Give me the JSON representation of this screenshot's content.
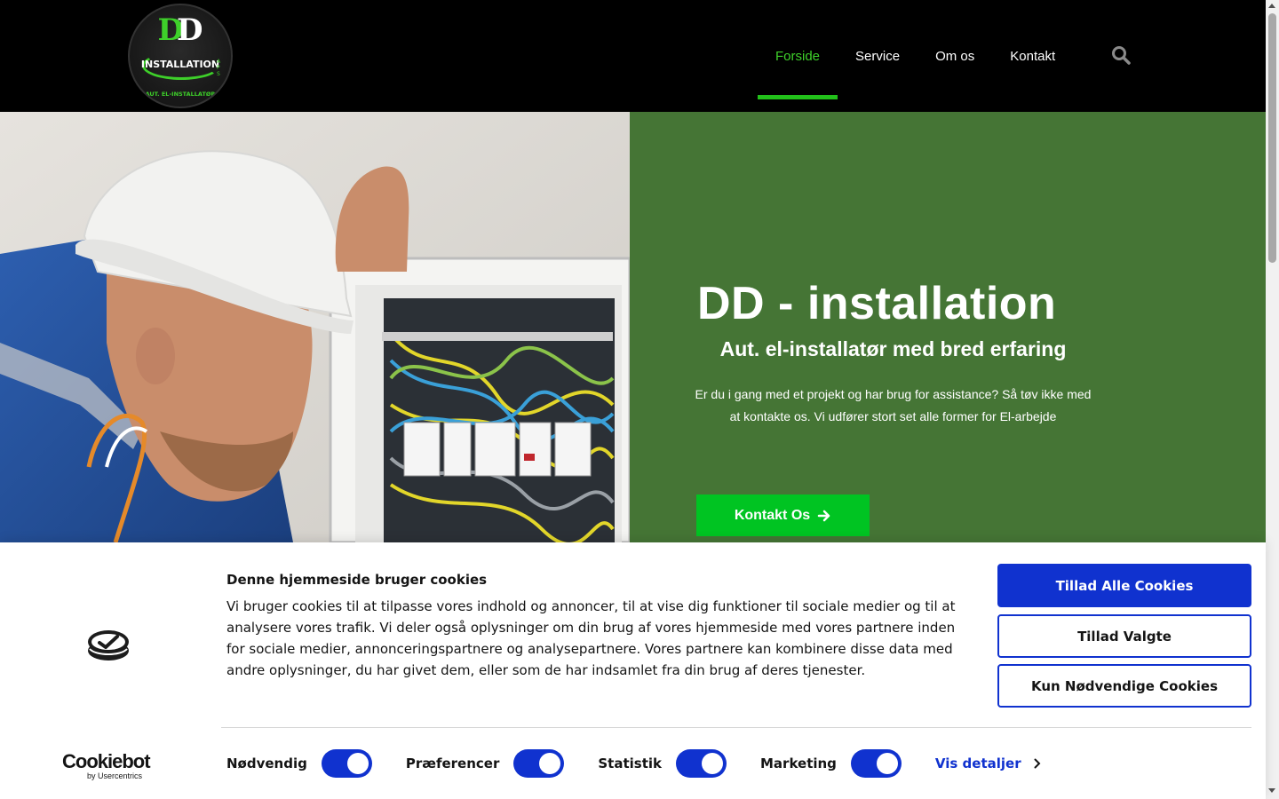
{
  "header": {
    "logo": {
      "letters_1": "D",
      "letters_2": "D",
      "wordmark": "INSTALLATION",
      "suffix": "APS",
      "tagline": "AUT. EL-INSTALLATØR"
    },
    "nav": [
      {
        "label": "Forside",
        "active": true
      },
      {
        "label": "Service",
        "active": false
      },
      {
        "label": "Om os",
        "active": false
      },
      {
        "label": "Kontakt",
        "active": false
      }
    ],
    "search_icon": "search-icon"
  },
  "hero": {
    "title": "DD - installation",
    "subtitle": "Aut. el-installatør med bred erfaring",
    "text": "Er du i gang med et projekt og har brug for assistance? Så tøv ikke med at kontakte os. Vi udfører stort set alle former for El-arbejde",
    "cta_label": "Kontakt Os",
    "cta_icon": "arrow-right-icon",
    "panel_color": "#457535",
    "cta_color": "#00c422"
  },
  "cookie": {
    "brand": "Cookiebot",
    "brand_sub": "by Usercentrics",
    "title": "Denne hjemmeside bruger cookies",
    "body": "Vi bruger cookies til at tilpasse vores indhold og annoncer, til at vise dig funktioner til sociale medier og til at analysere vores trafik. Vi deler også oplysninger om din brug af vores hjemmeside med vores partnere inden for sociale medier, annonceringspartnere og analysepartnere. Vores partnere kan kombinere disse data med andre oplysninger, du har givet dem, eller som de har indsamlet fra din brug af deres tjenester.",
    "buttons": {
      "allow_all": "Tillad Alle Cookies",
      "allow_selected": "Tillad Valgte",
      "necessary_only": "Kun Nødvendige Cookies"
    },
    "toggles": [
      {
        "label": "Nødvendig",
        "on": true
      },
      {
        "label": "Præferencer",
        "on": true
      },
      {
        "label": "Statistik",
        "on": true
      },
      {
        "label": "Marketing",
        "on": true
      }
    ],
    "details_label": "Vis detaljer",
    "accent_color": "#1032cf"
  }
}
